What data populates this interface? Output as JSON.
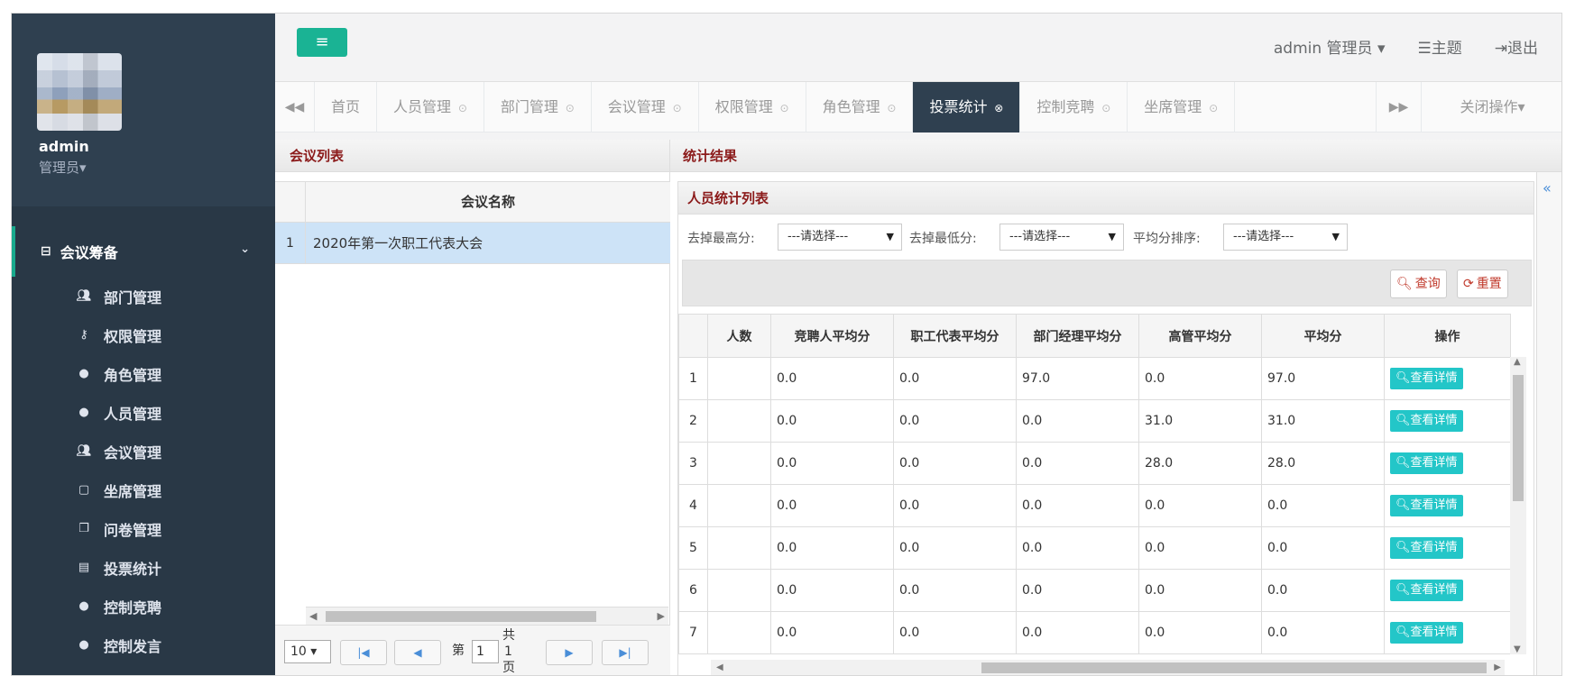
{
  "sidebar": {
    "user_name": "admin",
    "user_role": "管理员▾",
    "group": {
      "label": "会议筹备",
      "icon": "drawer-icon"
    },
    "items": [
      {
        "label": "部门管理",
        "icon": "group-icon"
      },
      {
        "label": "权限管理",
        "icon": "key-icon"
      },
      {
        "label": "角色管理",
        "icon": "user-icon"
      },
      {
        "label": "人员管理",
        "icon": "user-icon"
      },
      {
        "label": "会议管理",
        "icon": "group-icon"
      },
      {
        "label": "坐席管理",
        "icon": "comment-icon"
      },
      {
        "label": "问卷管理",
        "icon": "copy-icon"
      },
      {
        "label": "投票统计",
        "icon": "list-icon"
      },
      {
        "label": "控制竞聘",
        "icon": "user-icon"
      },
      {
        "label": "控制发言",
        "icon": "user-icon"
      }
    ]
  },
  "header": {
    "user": "admin 管理员 ▾",
    "theme": "主题",
    "logout": "退出"
  },
  "tabs": [
    {
      "label": "首页",
      "closable": false
    },
    {
      "label": "人员管理",
      "closable": true
    },
    {
      "label": "部门管理",
      "closable": true
    },
    {
      "label": "会议管理",
      "closable": true
    },
    {
      "label": "权限管理",
      "closable": true
    },
    {
      "label": "角色管理",
      "closable": true
    },
    {
      "label": "投票统计",
      "closable": true,
      "active": true
    },
    {
      "label": "控制竞聘",
      "closable": true
    },
    {
      "label": "坐席管理",
      "closable": true
    }
  ],
  "tab_close_ops": "关闭操作▾",
  "meeting_panel": {
    "title": "会议列表",
    "column": "会议名称",
    "rows": [
      {
        "no": "1",
        "name": "2020年第一次职工代表大会"
      }
    ],
    "pager": {
      "page_size": "10",
      "page_prefix": "第",
      "page": "1",
      "total_prefix": "共",
      "total": "1",
      "total_suffix": "页"
    }
  },
  "result_panel": {
    "title": "统计结果",
    "sub_title": "人员统计列表",
    "filters": [
      {
        "label": "去掉最高分:",
        "value": "---请选择---"
      },
      {
        "label": "去掉最低分:",
        "value": "---请选择---"
      },
      {
        "label": "平均分排序:",
        "value": "---请选择---"
      }
    ],
    "query_label": "查询",
    "reset_label": "重置",
    "columns": [
      "人数",
      "竞聘人平均分",
      "职工代表平均分",
      "部门经理平均分",
      "高管平均分",
      "平均分",
      "操作"
    ],
    "detail_label": "查看详情",
    "rows": [
      {
        "no": "1",
        "a": "0.0",
        "b": "0.0",
        "c": "97.0",
        "d": "0.0",
        "e": "97.0"
      },
      {
        "no": "2",
        "a": "0.0",
        "b": "0.0",
        "c": "0.0",
        "d": "31.0",
        "e": "31.0"
      },
      {
        "no": "3",
        "a": "0.0",
        "b": "0.0",
        "c": "0.0",
        "d": "28.0",
        "e": "28.0"
      },
      {
        "no": "4",
        "a": "0.0",
        "b": "0.0",
        "c": "0.0",
        "d": "0.0",
        "e": "0.0"
      },
      {
        "no": "5",
        "a": "0.0",
        "b": "0.0",
        "c": "0.0",
        "d": "0.0",
        "e": "0.0"
      },
      {
        "no": "6",
        "a": "0.0",
        "b": "0.0",
        "c": "0.0",
        "d": "0.0",
        "e": "0.0"
      },
      {
        "no": "7",
        "a": "0.0",
        "b": "0.0",
        "c": "0.0",
        "d": "0.0",
        "e": "0.0"
      }
    ]
  },
  "colors": {
    "sidebar": "#2f4050",
    "accent": "#1ab394",
    "detail_button": "#23c6c8",
    "panel_title": "#8b1a1a"
  }
}
